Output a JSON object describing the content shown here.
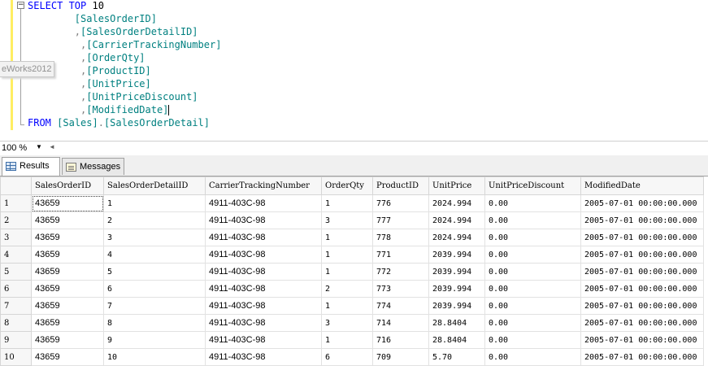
{
  "editor": {
    "lines": [
      {
        "parts": [
          [
            "kw",
            "SELECT TOP"
          ],
          [
            "pl",
            " "
          ],
          [
            "pl",
            "10"
          ]
        ]
      },
      {
        "parts": [
          [
            "pl",
            "        "
          ],
          [
            "id",
            "[SalesOrderID]"
          ]
        ]
      },
      {
        "parts": [
          [
            "pl",
            "        "
          ],
          [
            "pu",
            ","
          ],
          [
            "id",
            "[SalesOrderDetailID]"
          ]
        ]
      },
      {
        "parts": [
          [
            "pl",
            "         "
          ],
          [
            "pu",
            ","
          ],
          [
            "id",
            "[CarrierTrackingNumber]"
          ]
        ]
      },
      {
        "parts": [
          [
            "pl",
            "         "
          ],
          [
            "pu",
            ","
          ],
          [
            "id",
            "[OrderQty]"
          ]
        ]
      },
      {
        "parts": [
          [
            "pl",
            "         "
          ],
          [
            "pu",
            ","
          ],
          [
            "id",
            "[ProductID]"
          ]
        ]
      },
      {
        "parts": [
          [
            "pl",
            "         "
          ],
          [
            "pu",
            ","
          ],
          [
            "id",
            "[UnitPrice]"
          ]
        ]
      },
      {
        "parts": [
          [
            "pl",
            "         "
          ],
          [
            "pu",
            ","
          ],
          [
            "id",
            "[UnitPriceDiscount]"
          ]
        ]
      },
      {
        "parts": [
          [
            "pl",
            "         "
          ],
          [
            "pu",
            ","
          ],
          [
            "id",
            "[ModifiedDate]"
          ],
          [
            "caret",
            ""
          ]
        ]
      },
      {
        "parts": [
          [
            "kw",
            "FROM"
          ],
          [
            "pl",
            " "
          ],
          [
            "id",
            "[Sales]"
          ],
          [
            "pu",
            "."
          ],
          [
            "id",
            "[SalesOrderDetail]"
          ]
        ]
      }
    ],
    "collapse_symbol": "−",
    "db_tooltip": "eWorks2012"
  },
  "zoom": {
    "value": "100 %",
    "dropdown_icon": "▼",
    "scroll_left_icon": "◄"
  },
  "tabs": [
    {
      "label": "Results",
      "icon": "grid-icon",
      "active": true
    },
    {
      "label": "Messages",
      "icon": "messages-icon",
      "active": false
    }
  ],
  "results": {
    "columns": [
      "SalesOrderID",
      "SalesOrderDetailID",
      "CarrierTrackingNumber",
      "OrderQty",
      "ProductID",
      "UnitPrice",
      "UnitPriceDiscount",
      "ModifiedDate"
    ],
    "rows": [
      [
        "1",
        "43659",
        "1",
        "4911-403C-98",
        "1",
        "776",
        "2024.994",
        "0.00",
        "2005-07-01 00:00:00.000"
      ],
      [
        "2",
        "43659",
        "2",
        "4911-403C-98",
        "3",
        "777",
        "2024.994",
        "0.00",
        "2005-07-01 00:00:00.000"
      ],
      [
        "3",
        "43659",
        "3",
        "4911-403C-98",
        "1",
        "778",
        "2024.994",
        "0.00",
        "2005-07-01 00:00:00.000"
      ],
      [
        "4",
        "43659",
        "4",
        "4911-403C-98",
        "1",
        "771",
        "2039.994",
        "0.00",
        "2005-07-01 00:00:00.000"
      ],
      [
        "5",
        "43659",
        "5",
        "4911-403C-98",
        "1",
        "772",
        "2039.994",
        "0.00",
        "2005-07-01 00:00:00.000"
      ],
      [
        "6",
        "43659",
        "6",
        "4911-403C-98",
        "2",
        "773",
        "2039.994",
        "0.00",
        "2005-07-01 00:00:00.000"
      ],
      [
        "7",
        "43659",
        "7",
        "4911-403C-98",
        "1",
        "774",
        "2039.994",
        "0.00",
        "2005-07-01 00:00:00.000"
      ],
      [
        "8",
        "43659",
        "8",
        "4911-403C-98",
        "3",
        "714",
        "28.8404",
        "0.00",
        "2005-07-01 00:00:00.000"
      ],
      [
        "9",
        "43659",
        "9",
        "4911-403C-98",
        "1",
        "716",
        "28.8404",
        "0.00",
        "2005-07-01 00:00:00.000"
      ],
      [
        "10",
        "43659",
        "10",
        "4911-403C-98",
        "6",
        "709",
        "5.70",
        "0.00",
        "2005-07-01 00:00:00.000"
      ]
    ],
    "selected_cell": [
      0,
      1
    ]
  }
}
